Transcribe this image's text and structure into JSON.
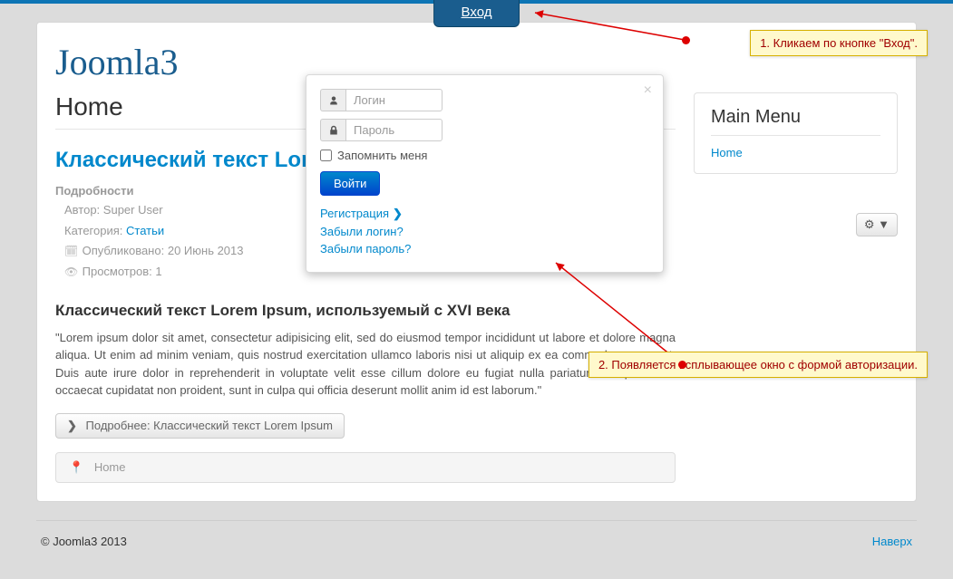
{
  "top_tab": {
    "label": "Вход"
  },
  "site": {
    "title": "Joomla3"
  },
  "page": {
    "heading": "Home"
  },
  "article": {
    "title": "Классический текст Loren",
    "details_heading": "Подробности",
    "author_label": "Автор:",
    "author": "Super User",
    "category_label": "Категория:",
    "category": "Статьи",
    "published_label": "Опубликовано:",
    "published": "20 Июнь 2013",
    "hits_label": "Просмотров:",
    "hits": "1",
    "heading": "Классический текст Lorem Ipsum, используемый с XVI века",
    "body": "\"Lorem ipsum dolor sit amet, consectetur adipisicing elit, sed do eiusmod tempor incididunt ut labore et dolore magna aliqua. Ut enim ad minim veniam, quis nostrud exercitation ullamco laboris nisi ut aliquip ex ea commodo consequat. Duis aute irure dolor in reprehenderit in voluptate velit esse cillum dolore eu fugiat nulla pariatur. Excepteur sint occaecat cupidatat non proident, sunt in culpa qui officia deserunt mollit anim id est laborum.\"",
    "readmore": "Подробнее: Классический текст Lorem Ipsum"
  },
  "gear": {
    "caret": "▼"
  },
  "breadcrumb": {
    "home": "Home"
  },
  "sidebar": {
    "title": "Main Menu",
    "items": [
      "Home"
    ]
  },
  "login": {
    "username_placeholder": "Логин",
    "password_placeholder": "Пароль",
    "remember": "Запомнить меня",
    "submit": "Войти",
    "register": "Регистрация",
    "forgot_login": "Забыли логин?",
    "forgot_password": "Забыли пароль?"
  },
  "footer": {
    "copyright": "© Joomla3 2013",
    "top": "Наверх"
  },
  "annot": {
    "a1": "1. Кликаем по кнопке \"Вход\".",
    "a2": "2. Появляется всплывающее окно с формой авторизации."
  }
}
